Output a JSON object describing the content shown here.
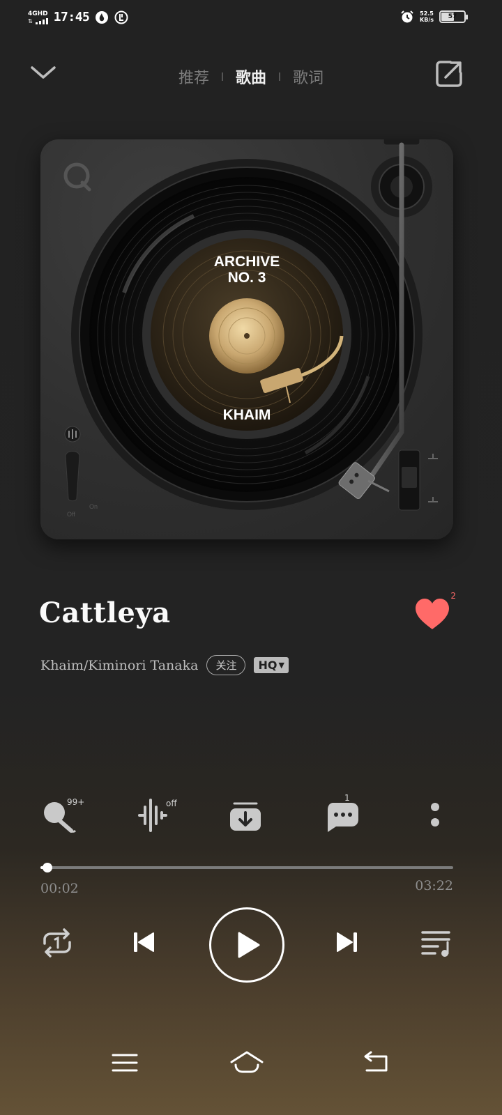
{
  "status_bar": {
    "network": "4GHD",
    "time": "17:45",
    "speed_value": "52.5",
    "speed_unit": "KB/s",
    "battery": "57",
    "battery_level": 0.57
  },
  "nav": {
    "tabs": [
      {
        "label": "推荐",
        "active": false
      },
      {
        "label": "歌曲",
        "active": true
      },
      {
        "label": "歌词",
        "active": false
      }
    ]
  },
  "album": {
    "label_line1": "ARCHIVE",
    "label_line2": "NO. 3",
    "label_artist": "KHAIM",
    "switch_off": "Off",
    "switch_on": "On"
  },
  "song": {
    "title": "Cattleya",
    "artist": "Khaim/Kiminori Tanaka",
    "follow_label": "关注",
    "quality_label": "HQ",
    "like_count": "2",
    "like_color": "#ff6a68"
  },
  "actions": {
    "karaoke_badge": "99+",
    "effect_badge": "off",
    "comment_badge": "1"
  },
  "playback": {
    "current_time": "00:02",
    "total_time": "03:22",
    "progress": 0.01
  },
  "colors": {
    "accent": "#ff6a68",
    "background_top": "#222222",
    "background_bottom": "#645236"
  }
}
